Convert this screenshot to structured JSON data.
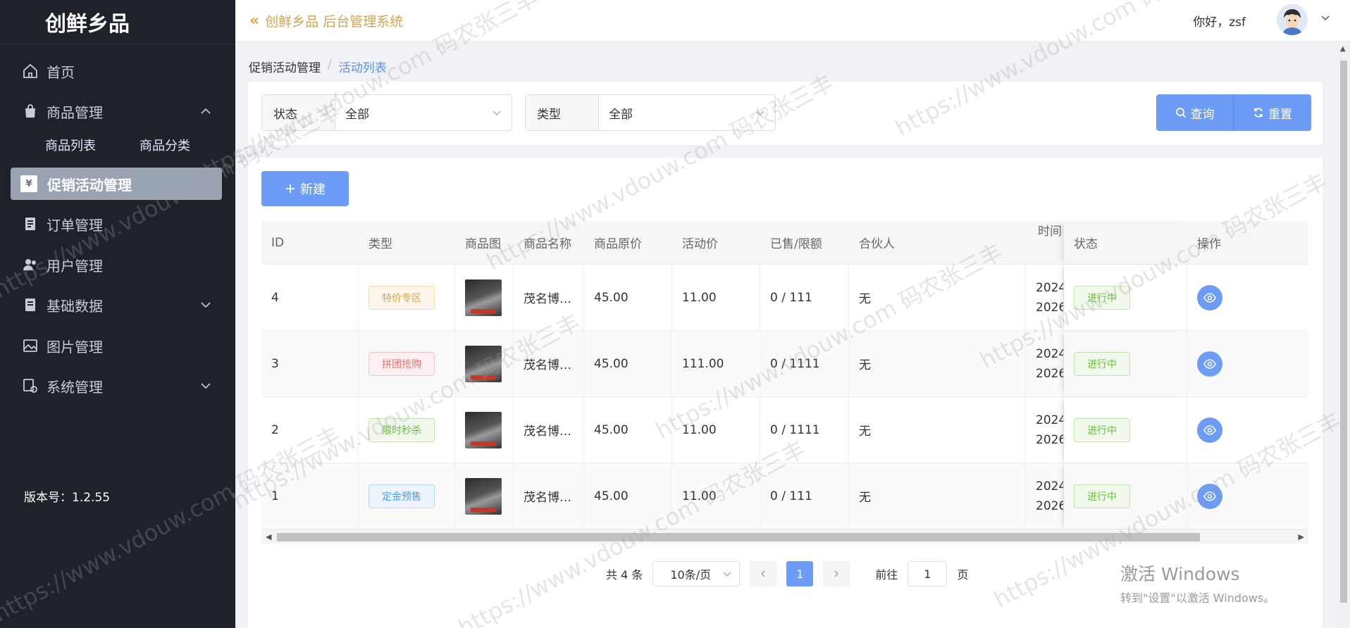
{
  "brand": "创鲜乡品",
  "header": {
    "collapse_icon": "«",
    "system_title": "创鲜乡品 后台管理系统",
    "greeting": "你好，zsf"
  },
  "sidebar": {
    "items": [
      {
        "label": "首页",
        "icon": "home-icon"
      },
      {
        "label": "商品管理",
        "icon": "bag-icon"
      },
      {
        "label": "订单管理",
        "icon": "order-icon"
      },
      {
        "label": "用户管理",
        "icon": "users-icon"
      },
      {
        "label": "基础数据",
        "icon": "data-icon"
      },
      {
        "label": "图片管理",
        "icon": "image-icon"
      },
      {
        "label": "系统管理",
        "icon": "system-icon"
      }
    ],
    "sub_items": [
      "商品列表",
      "商品分类"
    ],
    "active_item": "促销活动管理",
    "version": "版本号：1.2.55"
  },
  "breadcrumb": {
    "parent": "促销活动管理",
    "sep": "/",
    "current": "活动列表"
  },
  "filters": {
    "status_label": "状态",
    "status_value": "全部",
    "type_label": "类型",
    "type_value": "全部",
    "query_label": "查询",
    "reset_label": "重置"
  },
  "new_button_label": "新建",
  "table": {
    "headers": [
      "ID",
      "类型",
      "商品图",
      "商品名称",
      "商品原价",
      "活动价",
      "已售/限额",
      "合伙人",
      "时间",
      "状态",
      "操作"
    ],
    "rows": [
      {
        "id": "4",
        "type": "特价专区",
        "tag": "special",
        "name": "茂名博…",
        "orig": "45.00",
        "act": "11.00",
        "sold": "0 / 111",
        "partner": "无",
        "t1": "2024-",
        "t2": "2026-",
        "status": "进行中"
      },
      {
        "id": "3",
        "type": "拼团抢购",
        "tag": "group",
        "name": "茂名博…",
        "orig": "45.00",
        "act": "111.00",
        "sold": "0 / 1111",
        "partner": "无",
        "t1": "2024-",
        "t2": "2026-",
        "status": "进行中"
      },
      {
        "id": "2",
        "type": "限时秒杀",
        "tag": "flash",
        "name": "茂名博…",
        "orig": "45.00",
        "act": "11.00",
        "sold": "0 / 1111",
        "partner": "无",
        "t1": "2024-",
        "t2": "2026-",
        "status": "进行中"
      },
      {
        "id": "1",
        "type": "定金预售",
        "tag": "presale",
        "name": "茂名博…",
        "orig": "45.00",
        "act": "11.00",
        "sold": "0 / 111",
        "partner": "无",
        "t1": "2024-",
        "t2": "2026-",
        "status": "进行中"
      }
    ]
  },
  "pagination": {
    "total": "共 4 条",
    "page_size": "10条/页",
    "current": "1",
    "goto_label": "前往",
    "goto_value": "1",
    "page_suffix": "页"
  },
  "windows": {
    "line1": "激活 Windows",
    "line2": "转到\"设置\"以激活 Windows。"
  },
  "watermark": {
    "url": "https://www.vdouw.com",
    "name": "码农张三丰"
  },
  "colors": {
    "primary": "#6c9cf6",
    "sidebar_bg": "#1f2329",
    "brand_gold": "#d4a44a"
  }
}
